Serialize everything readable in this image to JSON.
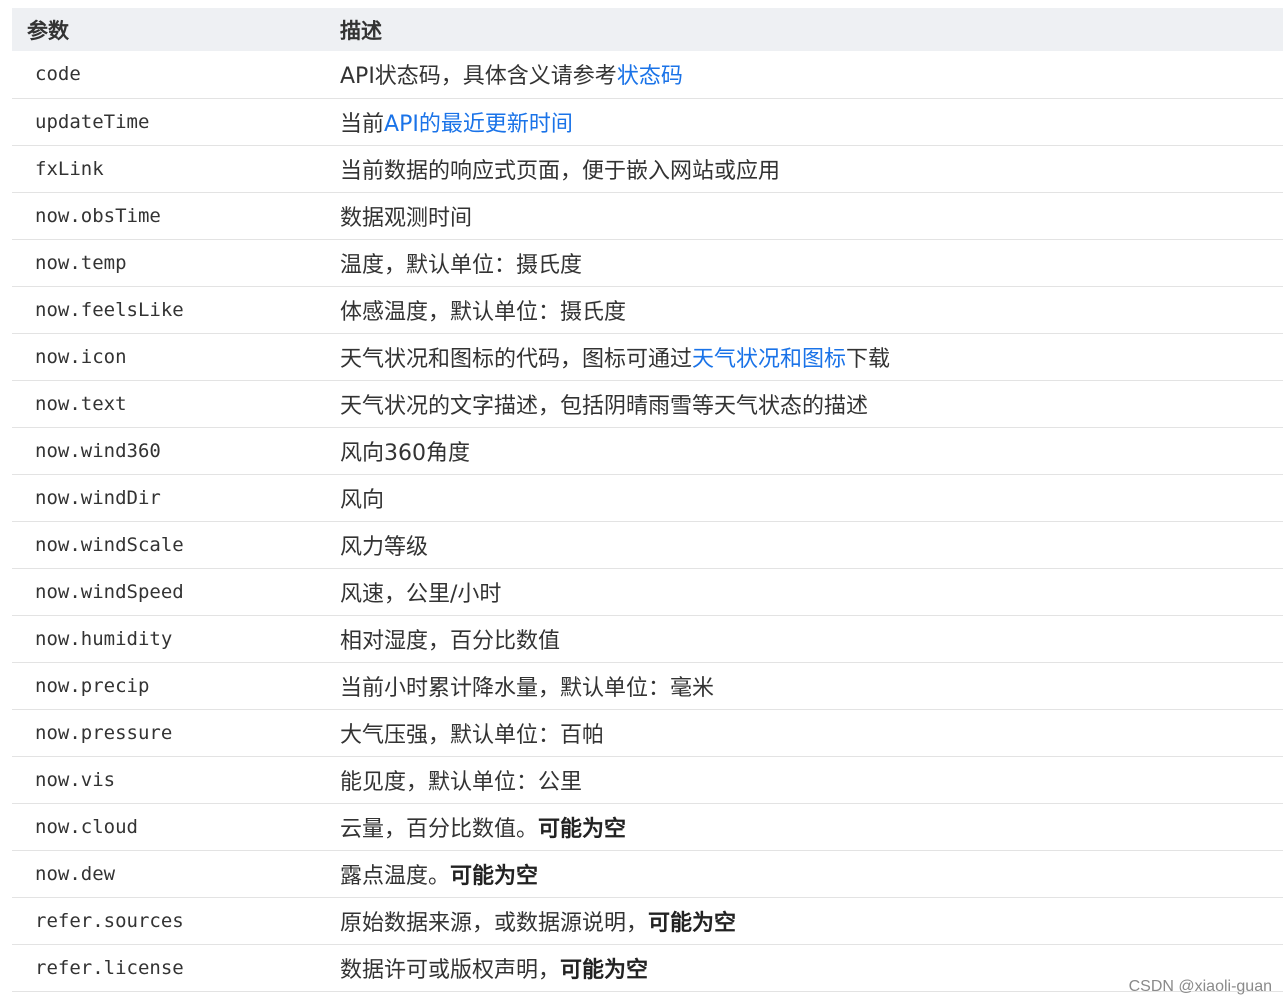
{
  "table": {
    "headers": [
      "参数",
      "描述"
    ],
    "rows": [
      {
        "param": "code",
        "desc": [
          {
            "text": "API状态码，具体含义请参考"
          },
          {
            "text": "状态码",
            "style": "link"
          }
        ]
      },
      {
        "param": "updateTime",
        "desc": [
          {
            "text": "当前"
          },
          {
            "text": "API的最近更新时间",
            "style": "link"
          }
        ]
      },
      {
        "param": "fxLink",
        "desc": [
          {
            "text": "当前数据的响应式页面，便于嵌入网站或应用"
          }
        ]
      },
      {
        "param": "now.obsTime",
        "desc": [
          {
            "text": "数据观测时间"
          }
        ]
      },
      {
        "param": "now.temp",
        "desc": [
          {
            "text": "温度，默认单位：摄氏度"
          }
        ]
      },
      {
        "param": "now.feelsLike",
        "desc": [
          {
            "text": "体感温度，默认单位：摄氏度"
          }
        ]
      },
      {
        "param": "now.icon",
        "desc": [
          {
            "text": "天气状况和图标的代码，图标可通过"
          },
          {
            "text": "天气状况和图标",
            "style": "link"
          },
          {
            "text": "下载"
          }
        ]
      },
      {
        "param": "now.text",
        "desc": [
          {
            "text": "天气状况的文字描述，包括阴晴雨雪等天气状态的描述"
          }
        ]
      },
      {
        "param": "now.wind360",
        "desc": [
          {
            "text": "风向360角度"
          }
        ]
      },
      {
        "param": "now.windDir",
        "desc": [
          {
            "text": "风向"
          }
        ]
      },
      {
        "param": "now.windScale",
        "desc": [
          {
            "text": "风力等级"
          }
        ]
      },
      {
        "param": "now.windSpeed",
        "desc": [
          {
            "text": "风速，公里/小时"
          }
        ]
      },
      {
        "param": "now.humidity",
        "desc": [
          {
            "text": "相对湿度，百分比数值"
          }
        ]
      },
      {
        "param": "now.precip",
        "desc": [
          {
            "text": "当前小时累计降水量，默认单位：毫米"
          }
        ]
      },
      {
        "param": "now.pressure",
        "desc": [
          {
            "text": "大气压强，默认单位：百帕"
          }
        ]
      },
      {
        "param": "now.vis",
        "desc": [
          {
            "text": "能见度，默认单位：公里"
          }
        ]
      },
      {
        "param": "now.cloud",
        "desc": [
          {
            "text": "云量，百分比数值。"
          },
          {
            "text": "可能为空",
            "style": "bold"
          }
        ]
      },
      {
        "param": "now.dew",
        "desc": [
          {
            "text": "露点温度。"
          },
          {
            "text": "可能为空",
            "style": "bold"
          }
        ]
      },
      {
        "param": "refer.sources",
        "desc": [
          {
            "text": "原始数据来源，或数据源说明，"
          },
          {
            "text": "可能为空",
            "style": "bold"
          }
        ]
      },
      {
        "param": "refer.license",
        "desc": [
          {
            "text": "数据许可或版权声明，"
          },
          {
            "text": "可能为空",
            "style": "bold"
          }
        ]
      }
    ]
  },
  "watermark": "CSDN @xiaoli-guan",
  "colors": {
    "header_bg": "#eef0f3",
    "link": "#1a73e8",
    "row_border": "#e3e3e3",
    "text": "#333333"
  }
}
